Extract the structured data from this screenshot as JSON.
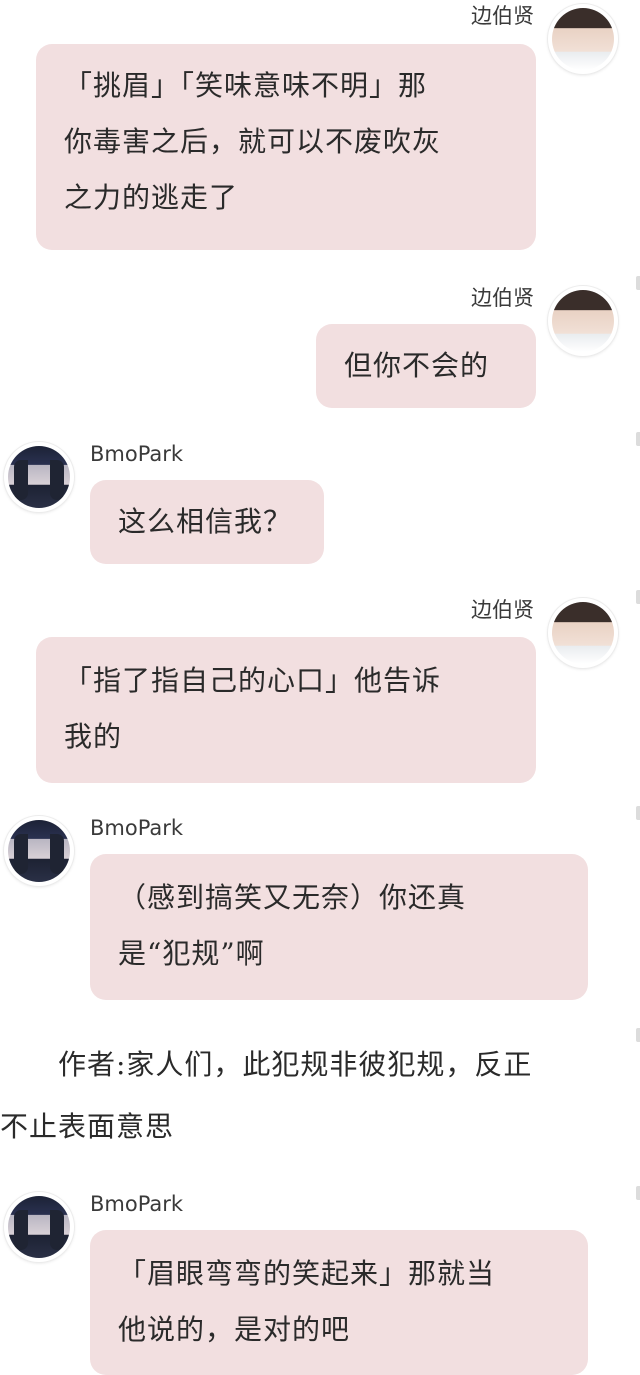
{
  "messages": [
    {
      "sender": "边伯贤",
      "side": "right",
      "lines": [
        "「挑眉」「笑味意味不明」那",
        "你毒害之后，就可以不废吹灰",
        "之力的逃走了"
      ]
    },
    {
      "sender": "边伯贤",
      "side": "right",
      "lines": [
        "但你不会的"
      ]
    },
    {
      "sender": "BmoPark",
      "side": "left",
      "lines": [
        "这么相信我？"
      ]
    },
    {
      "sender": "边伯贤",
      "side": "right",
      "lines": [
        "「指了指自己的心口」他告诉",
        "我的"
      ]
    },
    {
      "sender": "BmoPark",
      "side": "left",
      "lines": [
        "（感到搞笑又无奈）你还真",
        "是“犯规”啊"
      ]
    },
    {
      "sender": "BmoPark",
      "side": "left",
      "lines": [
        "「眉眼弯弯的笑起来」那就当",
        "他说的，是对的吧"
      ]
    }
  ],
  "narration": {
    "lines": [
      "　　作者:家人们，此犯规非彼犯规，反正",
      "不止表面意思"
    ]
  },
  "colors": {
    "bubble": "#f2dfe0",
    "text": "#2a2a2a",
    "name": "#3a3a3a",
    "background": "#ffffff"
  }
}
